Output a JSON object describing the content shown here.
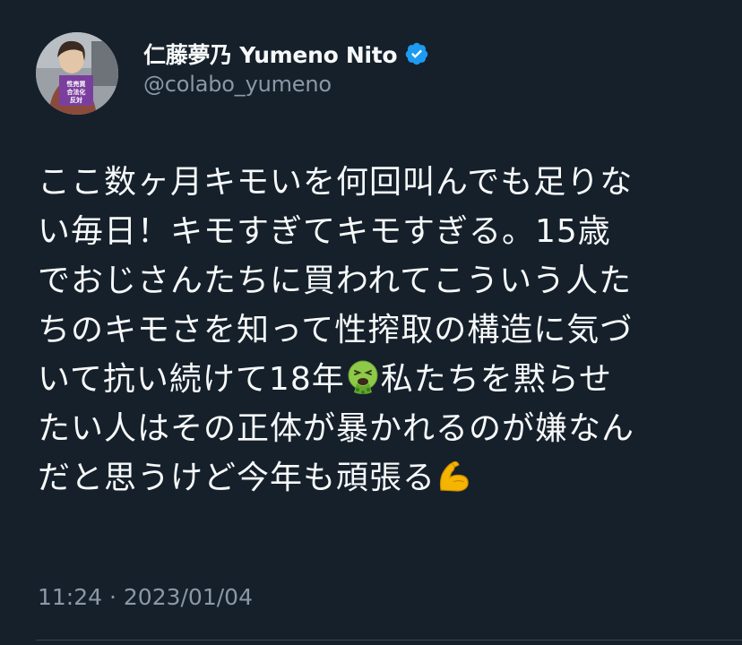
{
  "author": {
    "display_name": "仁藤夢乃  Yumeno Nito",
    "handle": "@colabo_yumeno",
    "verified": true,
    "avatar_sign_text": [
      "性売買",
      "合法化",
      "反対"
    ]
  },
  "tweet": {
    "lines": [
      {
        "segments": [
          "ここ数ヶ月キモいを何回叫んでも足りな"
        ]
      },
      {
        "segments": [
          "い毎日！キモすぎてキモすぎる。15歳"
        ]
      },
      {
        "segments": [
          "でおじさんたちに買われてこういう人た"
        ]
      },
      {
        "segments": [
          "ちのキモさを知って性搾取の構造に気づ"
        ]
      },
      {
        "segments": [
          "いて抗い続けて18年",
          "私たちを黙らせ"
        ]
      },
      {
        "segments": [
          "たい人はその正体が暴かれるのが嫌なん"
        ]
      },
      {
        "segments": [
          "だと思うけど今年も頑張る"
        ]
      }
    ],
    "emojis": [
      "vomiting-face",
      "flexed-biceps"
    ],
    "timestamp": "11:24 · 2023/01/04"
  },
  "colors": {
    "background": "#15202b",
    "text_primary": "#f7f9f9",
    "text_secondary": "#8b98a5",
    "verified_badge": "#1d9bf0"
  }
}
